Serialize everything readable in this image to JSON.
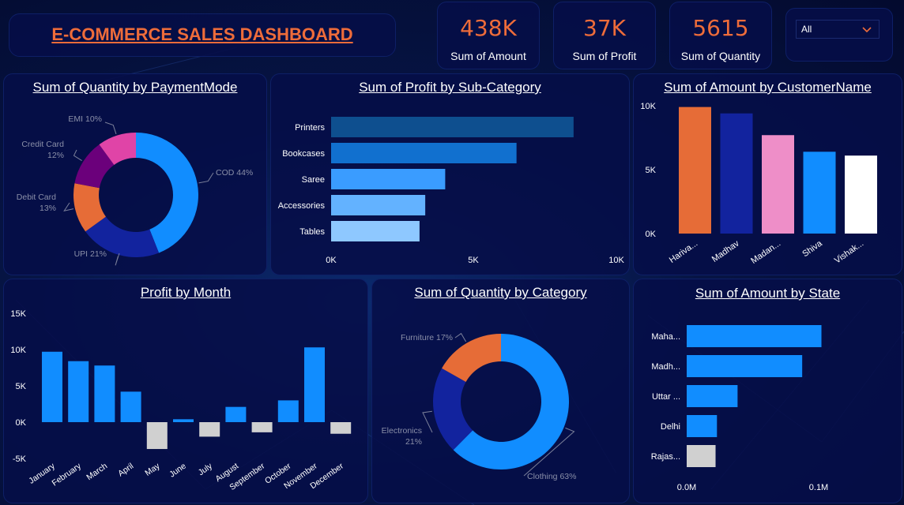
{
  "header": {
    "title": "E-COMMERCE SALES DASHBOARD"
  },
  "kpis": [
    {
      "value": "438K",
      "label": "Sum of Amount"
    },
    {
      "value": "37K",
      "label": "Sum of Profit"
    },
    {
      "value": "5615",
      "label": "Sum of Quantity"
    }
  ],
  "filter": {
    "selected": "All",
    "icon": "chevron-down-icon"
  },
  "colors": {
    "accent": "#ee6c3a",
    "blue": "#118dff",
    "navy": "#12239e",
    "pink": "#e66c37",
    "gray": "#d0d0d0"
  },
  "chart_data": [
    {
      "id": "payment",
      "type": "pie",
      "title": "Sum of Quantity by PaymentMode",
      "labels": [
        "COD",
        "UPI",
        "Debit Card",
        "Credit Card",
        "EMI"
      ],
      "values": [
        44,
        21,
        13,
        12,
        10
      ],
      "label_text": [
        "COD 44%",
        "UPI 21%",
        "Debit Card 13%",
        "Credit Card 12%",
        "EMI 10%"
      ],
      "colors": [
        "#118dff",
        "#12239e",
        "#e66c37",
        "#6b007b",
        "#e044a7"
      ]
    },
    {
      "id": "subcat",
      "type": "bar",
      "orientation": "horizontal",
      "title": "Sum of Profit by Sub-Category",
      "categories": [
        "Printers",
        "Bookcases",
        "Saree",
        "Accessories",
        "Tables"
      ],
      "values": [
        8500,
        6500,
        4000,
        3300,
        3100
      ],
      "xlim": [
        0,
        10000
      ],
      "ticks": [
        "0K",
        "5K",
        "10K"
      ],
      "colors": [
        "#0e4f8f",
        "#1170cf",
        "#3a9cff",
        "#63b2ff",
        "#8ec8ff"
      ]
    },
    {
      "id": "customer",
      "type": "bar",
      "title": "Sum of Amount by CustomerName",
      "categories": [
        "Hariva...",
        "Madhav",
        "Madan...",
        "Shiva",
        "Vishak..."
      ],
      "values": [
        9900,
        9400,
        7700,
        6400,
        6100
      ],
      "ylim": [
        0,
        10000
      ],
      "ticks": [
        "0K",
        "5K",
        "10K"
      ],
      "colors": [
        "#e66c37",
        "#12239e",
        "#ee8ec8",
        "#118dff",
        "#ffffff"
      ]
    },
    {
      "id": "month",
      "type": "bar",
      "title": "Profit by Month",
      "categories": [
        "January",
        "February",
        "March",
        "April",
        "May",
        "June",
        "July",
        "August",
        "September",
        "October",
        "November",
        "December"
      ],
      "values": [
        9700,
        8400,
        7800,
        4200,
        -3700,
        400,
        -2000,
        2100,
        -1400,
        3000,
        10300,
        -1600
      ],
      "ylim": [
        -5000,
        15000
      ],
      "ticks": [
        "-5K",
        "0K",
        "5K",
        "10K",
        "15K"
      ],
      "pos_color": "#118dff",
      "neg_color": "#d0d0d0"
    },
    {
      "id": "category",
      "type": "pie",
      "title": "Sum of Quantity by Category",
      "labels": [
        "Clothing",
        "Electronics",
        "Furniture"
      ],
      "values": [
        63,
        21,
        17
      ],
      "label_text": [
        "Clothing 63%",
        "Electronics 21%",
        "Furniture 17%"
      ],
      "colors": [
        "#118dff",
        "#12239e",
        "#e66c37"
      ]
    },
    {
      "id": "state",
      "type": "bar",
      "orientation": "horizontal",
      "title": "Sum of Amount by State",
      "categories": [
        "Maha...",
        "Madh...",
        "Uttar ...",
        "Delhi",
        "Rajas..."
      ],
      "values": [
        0.098,
        0.084,
        0.037,
        0.022,
        0.021
      ],
      "xlim": [
        0,
        0.1
      ],
      "ticks": [
        "0.0M",
        "0.1M"
      ],
      "colors": [
        "#118dff",
        "#118dff",
        "#118dff",
        "#118dff",
        "#d0d0d0"
      ]
    }
  ]
}
